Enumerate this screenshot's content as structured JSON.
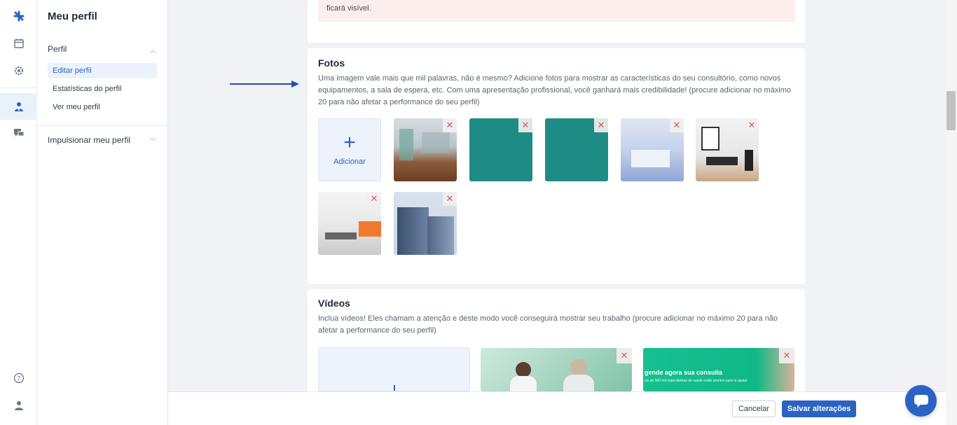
{
  "sidebar": {
    "title": "Meu perfil",
    "section_perfil": "Perfil",
    "items": [
      {
        "label": "Editar perfil"
      },
      {
        "label": "Estatísticas do perfil"
      },
      {
        "label": "Ver meu perfil"
      }
    ],
    "section_boost": "Impulsionar meu perfil"
  },
  "notice": {
    "text": "ficará visível."
  },
  "photos": {
    "title": "Fotos",
    "description": "Uma imagem vale mais que mil palavras, não é mesmo? Adicione fotos para mostrar as características do seu consultório, como novos equipamentos, a sala de espera, etc. Com uma apresentação profissional, você ganhará mais credibilidade! (procure adicionar no máximo 20 para não afetar a performance do seu perfil)",
    "add_label": "Adicionar",
    "remove_glyph": "✕"
  },
  "videos": {
    "title": "Vídeos",
    "description": "Inclua vídeos! Eles chamam a atenção e deste modo você conseguirá mostrar seu trabalho (procure adicionar no máximo 20 para não afetar a performance do seu perfil)",
    "promo_heading": "gende agora sua consulta",
    "promo_sub": "ais de 500 mil especialistas de saúde estão prontos para te ajudar"
  },
  "footer": {
    "cancel_label": "Cancelar",
    "save_label": "Salvar alterações"
  },
  "colors": {
    "accent": "#2a63c4",
    "remove": "#e05a4f",
    "notice_bg": "#fdeeee"
  },
  "icons": [
    "logo-icon",
    "calendar-icon",
    "gear-icon",
    "doctor-icon",
    "chat-icon",
    "help-icon",
    "user-icon",
    "arrow-icon",
    "chat-bubble-icon"
  ]
}
